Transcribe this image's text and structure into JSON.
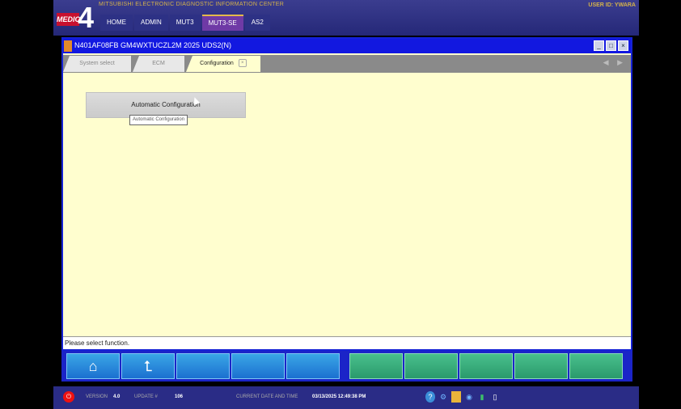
{
  "header": {
    "brand": "MITSUBISHI  ELECTRONIC  DIAGNOSTIC  INFORMATION  CENTER",
    "logo_text": "MEDIC",
    "logo_number": "4",
    "user_id": "USER ID:   YWARA",
    "nav_tabs": [
      {
        "label": "HOME"
      },
      {
        "label": "ADMIN"
      },
      {
        "label": "MUT3"
      },
      {
        "label": "MUT3-SE"
      },
      {
        "label": "AS2"
      }
    ]
  },
  "window": {
    "title": "N401AF08FB   GM4WXTUCZL2M 2025   UDS2(N)",
    "tabs": [
      {
        "label": "System select"
      },
      {
        "label": "ECM"
      },
      {
        "label": "Configuration"
      }
    ],
    "content": {
      "auto_config_button": "Automatic Configuration",
      "tooltip": "Automatic Configuration"
    },
    "status": "Please select function."
  },
  "footer": {
    "version_label": "VERSION",
    "version_value": "4.0",
    "update_label": "UPDATE #",
    "update_value": "106",
    "datetime_label": "CURRENT DATE AND TIME",
    "datetime_value": "03/13/2025 12:49:38 PM"
  },
  "colors": {
    "window_bg": "#fffecf",
    "title_bar": "#1218e0",
    "button_blue": "#1b70d0",
    "button_green": "#2a9a6c"
  }
}
